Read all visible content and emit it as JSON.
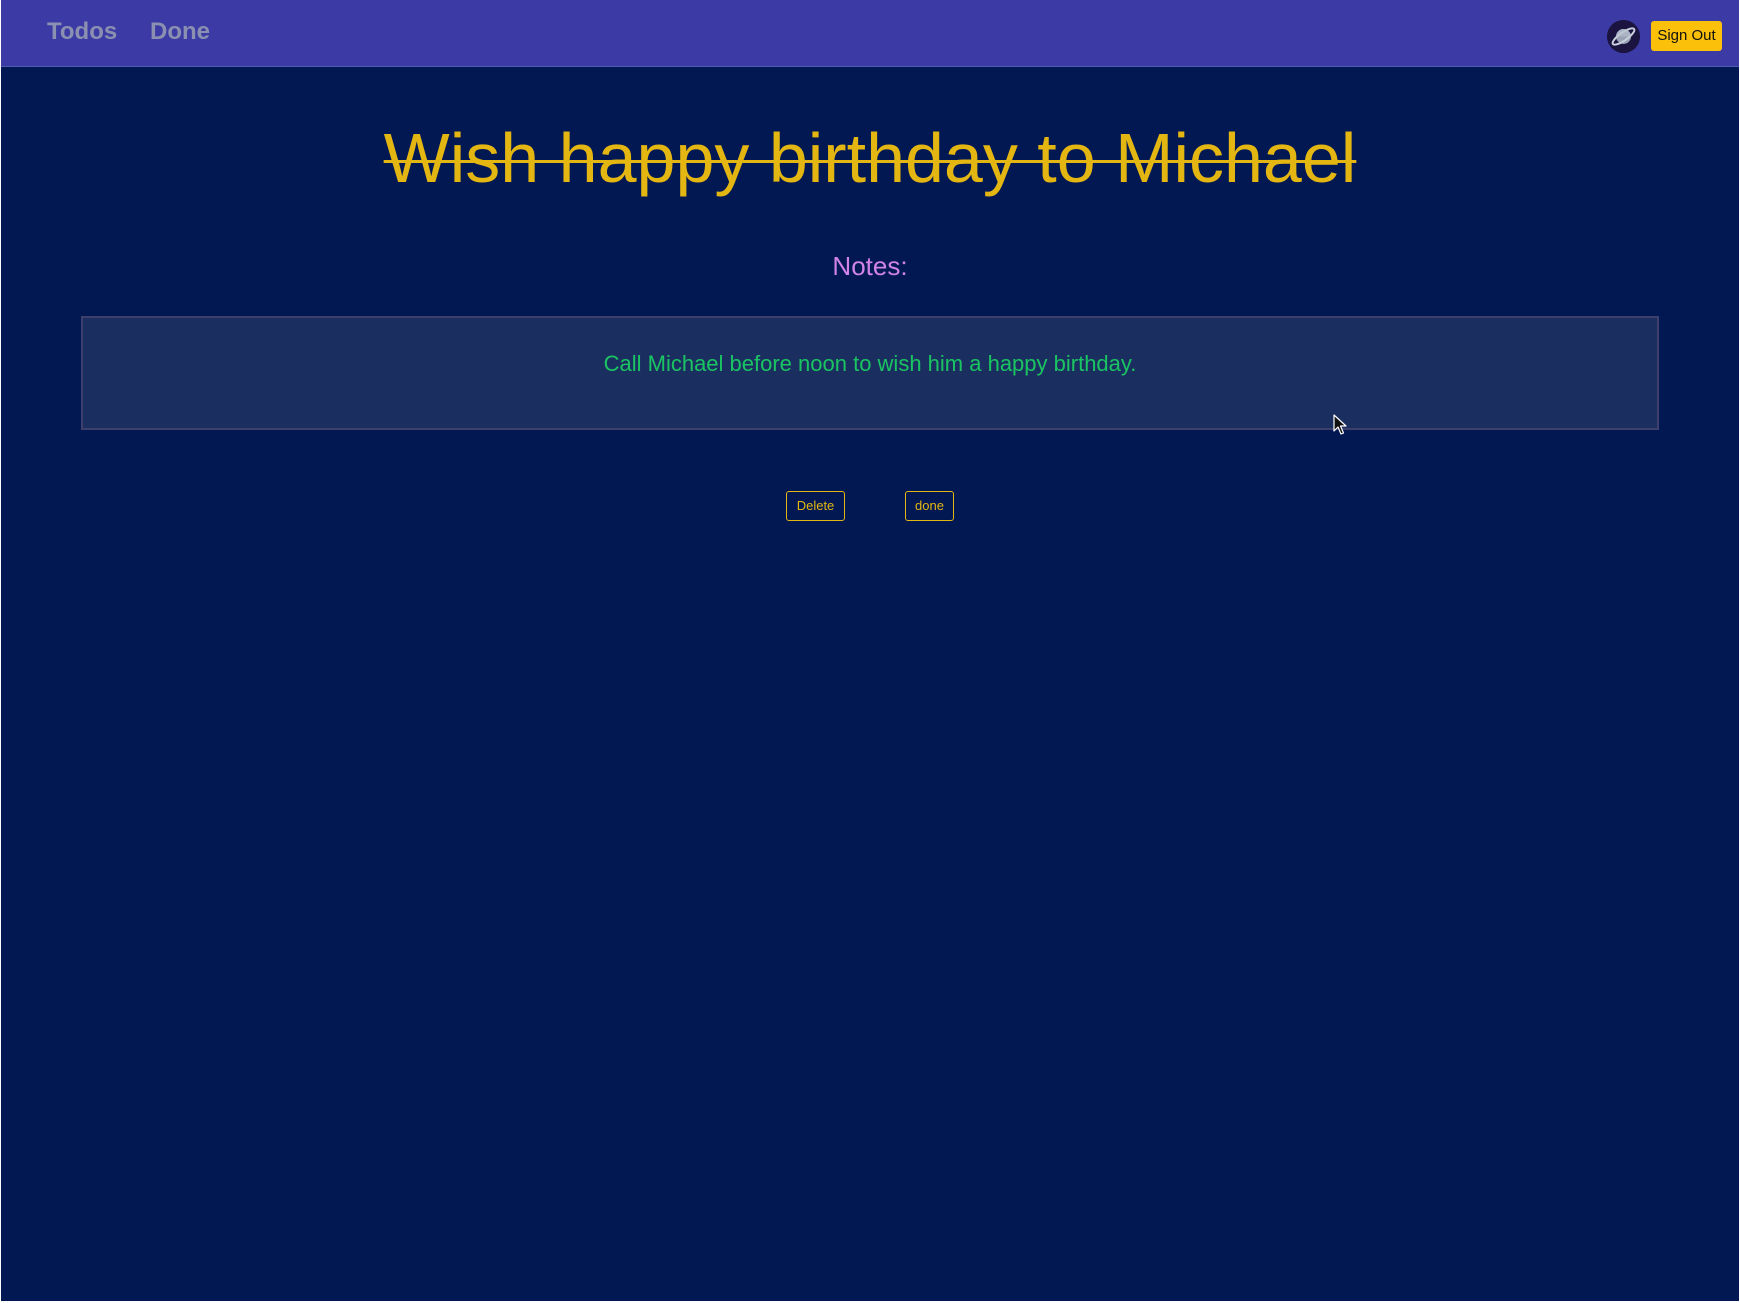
{
  "nav": {
    "links": [
      {
        "label": "Todos"
      },
      {
        "label": "Done"
      }
    ],
    "avatar_icon": "planet-avatar-icon",
    "sign_out_label": "Sign Out"
  },
  "todo": {
    "title": "Wish happy birthday to Michael",
    "completed": true,
    "notes_label": "Notes:",
    "notes": "Call Michael before noon to wish him a happy birthday."
  },
  "actions": {
    "delete_label": "Delete",
    "done_label": "done"
  },
  "colors": {
    "page_background": "#011852",
    "navbar": "#3c3ba5",
    "title": "#e4b612",
    "notes_label": "#d183e8",
    "notes_text": "#1ac462",
    "notes_box": "#1a2f60",
    "sign_out_button": "#fbc00a"
  }
}
